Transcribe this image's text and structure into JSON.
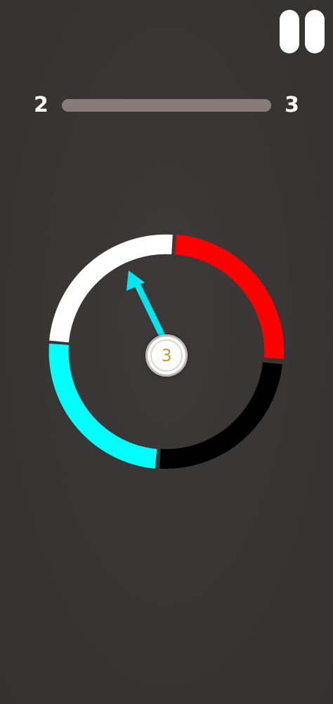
{
  "hud": {
    "pause_icon": "pause-icon",
    "level_current": "2",
    "level_next": "3",
    "level_progress_fraction": 0.0
  },
  "wheel": {
    "segments": [
      {
        "name": "white",
        "color": "#ffffff"
      },
      {
        "name": "red",
        "color": "#ff0000"
      },
      {
        "name": "black",
        "color": "#000000"
      },
      {
        "name": "cyan",
        "color": "#00ffff"
      }
    ],
    "pointer_color": "#00e5ee",
    "ball_count": "3"
  }
}
